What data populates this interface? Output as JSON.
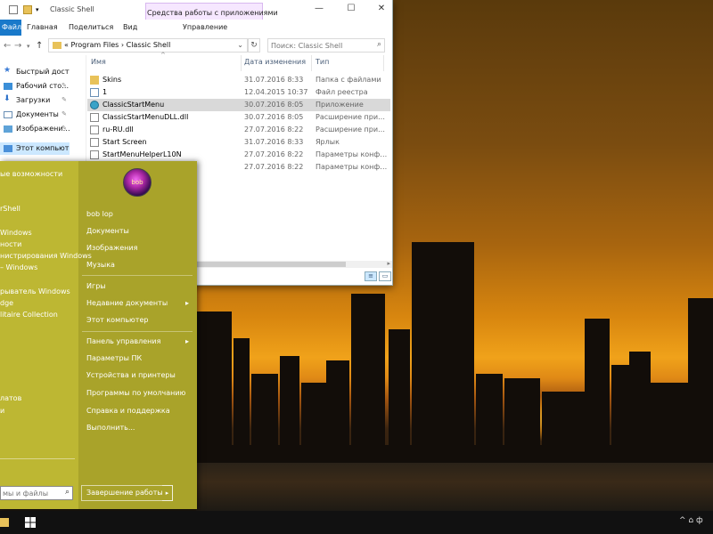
{
  "explorer": {
    "title": "Classic Shell",
    "context_tab": "Средства работы с приложениями",
    "ribbon_tabs": [
      "Файл",
      "Главная",
      "Поделиться",
      "Вид",
      "Управление"
    ],
    "window_buttons": {
      "minimize": "—",
      "maximize": "☐",
      "close": "✕"
    },
    "address": {
      "prefix": "«",
      "path": [
        "Program Files",
        "Classic Shell"
      ],
      "separator": "›"
    },
    "search": {
      "placeholder": "Поиск: Classic Shell"
    },
    "nav_pane": [
      {
        "label": "Быстрый доступ",
        "icon": "star-icon",
        "pinned": false
      },
      {
        "label": "Рабочий сто…",
        "icon": "desktop-icon",
        "pinned": true
      },
      {
        "label": "Загрузки",
        "icon": "download-icon",
        "pinned": true
      },
      {
        "label": "Документы",
        "icon": "documents-icon",
        "pinned": true
      },
      {
        "label": "Изображени…",
        "icon": "pictures-icon",
        "pinned": true
      },
      {
        "label": "Этот компьютер",
        "icon": "computer-icon",
        "pinned": false,
        "selected": true
      }
    ],
    "columns": {
      "name": "Имя",
      "date": "Дата изменения",
      "type": "Тип"
    },
    "files": [
      {
        "name": "Skins",
        "date": "31.07.2016 8:33",
        "type": "Папка с файлами",
        "icon": "folder-icon"
      },
      {
        "name": "1",
        "date": "12.04.2015 10:37",
        "type": "Файл реестра",
        "icon": "registry-file-icon"
      },
      {
        "name": "ClassicStartMenu",
        "date": "30.07.2016 8:05",
        "type": "Приложение",
        "icon": "classic-shell-icon",
        "selected": true
      },
      {
        "name": "ClassicStartMenuDLL.dll",
        "date": "30.07.2016 8:05",
        "type": "Расширение при…",
        "icon": "dll-icon"
      },
      {
        "name": "ru-RU.dll",
        "date": "27.07.2016 8:22",
        "type": "Расширение при…",
        "icon": "dll-icon"
      },
      {
        "name": "Start Screen",
        "date": "31.07.2016 8:33",
        "type": "Ярлык",
        "icon": "shortcut-icon"
      },
      {
        "name": "StartMenuHelperL10N",
        "date": "27.07.2016 8:22",
        "type": "Параметры конф…",
        "icon": "config-file-icon"
      },
      {
        "name": "",
        "date": "27.07.2016 8:22",
        "type": "Параметры конф…",
        "icon": "config-file-icon"
      }
    ]
  },
  "start_menu": {
    "left_items": [
      "ые возможности",
      "rShell",
      "Windows",
      "ности",
      "нистрирования Windows",
      "– Windows",
      "рыватель Windows",
      "dge",
      "litaire Collection",
      "латов",
      "и"
    ],
    "search_placeholder": "мы и файлы",
    "user": {
      "name": "bob lop",
      "avatar_text": "bob"
    },
    "right_items": [
      {
        "label": "bob lop",
        "arrow": false
      },
      {
        "label": "Документы",
        "arrow": false
      },
      {
        "label": "Изображения",
        "arrow": false
      },
      {
        "label": "Музыка",
        "arrow": false
      },
      {
        "label": "Игры",
        "arrow": false
      },
      {
        "label": "Недавние документы",
        "arrow": true
      },
      {
        "label": "Этот компьютер",
        "arrow": false
      },
      {
        "label": "Панель управления",
        "arrow": true
      },
      {
        "label": "Параметры ПК",
        "arrow": false
      },
      {
        "label": "Устройства и принтеры",
        "arrow": false
      },
      {
        "label": "Программы по умолчанию",
        "arrow": false
      },
      {
        "label": "Справка и поддержка",
        "arrow": false
      },
      {
        "label": "Выполнить...",
        "arrow": false
      }
    ],
    "shutdown_label": "Завершение работы"
  },
  "taskbar": {
    "tray_text": "^ ⌂ ф"
  },
  "colors": {
    "start_menu": "#a9a32a",
    "file_tab": "#1979ca",
    "selection": "#d9d9d9"
  }
}
